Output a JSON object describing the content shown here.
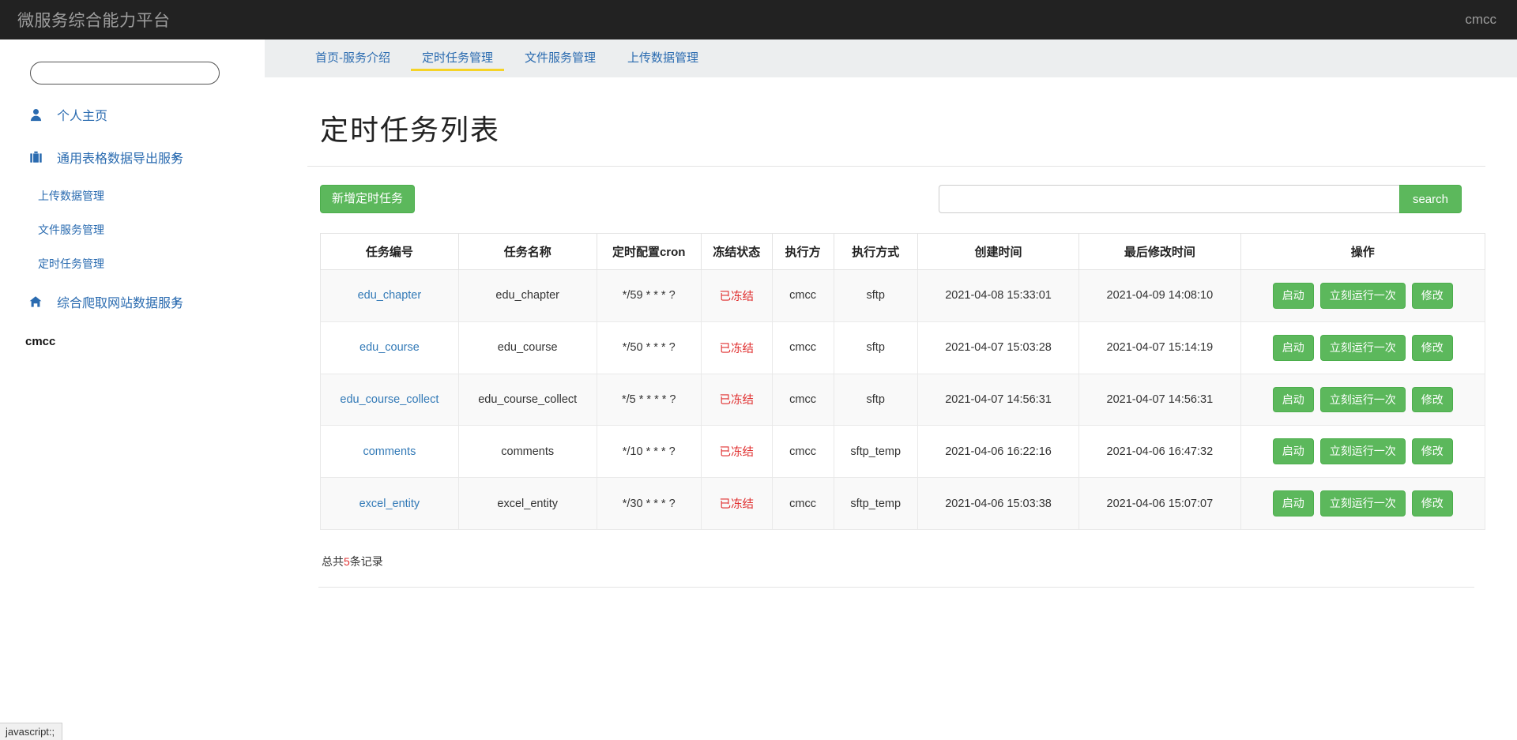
{
  "topbar": {
    "title": "微服务综合能力平台",
    "user": "cmcc"
  },
  "sidebar": {
    "search_placeholder": "",
    "search_value": "",
    "items": [
      {
        "label": "个人主页",
        "icon": "user-icon"
      },
      {
        "label": "通用表格数据导出服务",
        "icon": "briefcase-icon",
        "action": "×"
      },
      {
        "label": "综合爬取网站数据服务",
        "icon": "home-icon",
        "action": "+"
      }
    ],
    "sub_items": [
      "上传数据管理",
      "文件服务管理",
      "定时任务管理"
    ],
    "footer_user": "cmcc"
  },
  "nav": {
    "tabs": [
      {
        "label": "首页-服务介绍",
        "active": false
      },
      {
        "label": "定时任务管理",
        "active": true
      },
      {
        "label": "文件服务管理",
        "active": false
      },
      {
        "label": "上传数据管理",
        "active": false
      }
    ]
  },
  "main": {
    "page_title": "定时任务列表",
    "add_button": "新增定时任务",
    "search_placeholder": "",
    "search_value": "",
    "search_button": "search",
    "total_prefix": "总共",
    "total_count": "5",
    "total_suffix": "条记录"
  },
  "table": {
    "headers": [
      "任务编号",
      "任务名称",
      "定时配置cron",
      "冻结状态",
      "执行方",
      "执行方式",
      "创建时间",
      "最后修改时间",
      "操作"
    ],
    "op_labels": [
      "启动",
      "立刻运行一次",
      "修改"
    ],
    "rows": [
      {
        "id": "edu_chapter",
        "name": "edu_chapter",
        "cron": "*/59 * * * ?",
        "status": "已冻结",
        "executor": "cmcc",
        "mode": "sftp",
        "created": "2021-04-08 15:33:01",
        "modified": "2021-04-09 14:08:10"
      },
      {
        "id": "edu_course",
        "name": "edu_course",
        "cron": "*/50 * * * ?",
        "status": "已冻结",
        "executor": "cmcc",
        "mode": "sftp",
        "created": "2021-04-07 15:03:28",
        "modified": "2021-04-07 15:14:19"
      },
      {
        "id": "edu_course_collect",
        "name": "edu_course_collect",
        "cron": "*/5 * * * * ?",
        "status": "已冻结",
        "executor": "cmcc",
        "mode": "sftp",
        "created": "2021-04-07 14:56:31",
        "modified": "2021-04-07 14:56:31"
      },
      {
        "id": "comments",
        "name": "comments",
        "cron": "*/10 * * * ?",
        "status": "已冻结",
        "executor": "cmcc",
        "mode": "sftp_temp",
        "created": "2021-04-06 16:22:16",
        "modified": "2021-04-06 16:47:32"
      },
      {
        "id": "excel_entity",
        "name": "excel_entity",
        "cron": "*/30 * * * ?",
        "status": "已冻结",
        "executor": "cmcc",
        "mode": "sftp_temp",
        "created": "2021-04-06 15:03:38",
        "modified": "2021-04-06 15:07:07"
      }
    ]
  },
  "statusbar": {
    "text": "javascript:;"
  },
  "colors": {
    "topbar_bg": "#222222",
    "link": "#2a6bb0",
    "green": "#5cb85c",
    "danger": "#e03030",
    "active_tab_underline": "#f5d327"
  }
}
